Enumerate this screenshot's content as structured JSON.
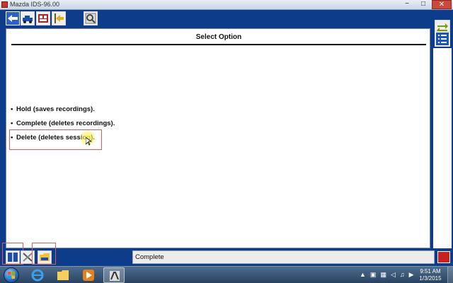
{
  "window": {
    "title": "Mazda IDS-96.00",
    "minimize": "−",
    "maximize": "□",
    "close": "✕"
  },
  "toolbar": {
    "icons": [
      "back-icon",
      "vehicle-icon",
      "toolbox-icon",
      "exit-icon",
      "search-icon"
    ]
  },
  "panel": {
    "title": "Select Option",
    "options": [
      {
        "bullet": "•",
        "label": "Hold (saves recordings)."
      },
      {
        "bullet": "•",
        "label": "Complete (deletes recordings)."
      },
      {
        "bullet": "•",
        "label": "Delete (deletes session)."
      }
    ],
    "selected_index": 2
  },
  "right": {
    "icons": [
      "tick-forward-icon",
      "list-icon"
    ]
  },
  "status_bar": {
    "text": "Complete"
  },
  "taskbar": {
    "apps": [
      "internet-explorer-icon",
      "folder-icon",
      "media-player-icon",
      "ids-app-icon"
    ],
    "tray_icons": [
      "▲",
      "▣",
      "▦",
      "◁",
      "♫",
      "▶"
    ],
    "time": "9:51 AM",
    "date": "1/3/2015"
  },
  "colors": {
    "chrome_blue": "#0d3d8a",
    "selection_red": "#e05a5a",
    "stop_red": "#c62222"
  }
}
